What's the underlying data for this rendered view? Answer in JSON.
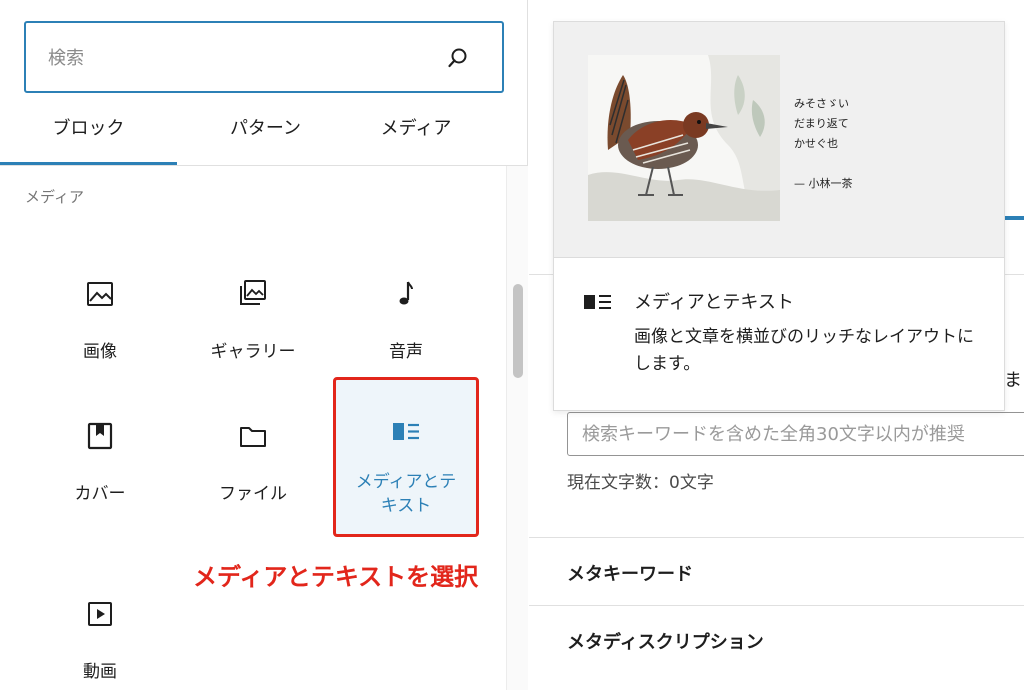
{
  "search": {
    "placeholder": "検索"
  },
  "tabs": [
    {
      "label": "ブロック",
      "active": true
    },
    {
      "label": "パターン",
      "active": false
    },
    {
      "label": "メディア",
      "active": false
    }
  ],
  "category": {
    "title": "メディア"
  },
  "blocks": [
    {
      "label": "画像",
      "icon": "image-icon"
    },
    {
      "label": "ギャラリー",
      "icon": "gallery-icon"
    },
    {
      "label": "音声",
      "icon": "audio-icon"
    },
    {
      "label": "カバー",
      "icon": "cover-icon"
    },
    {
      "label": "ファイル",
      "icon": "file-icon"
    },
    {
      "label": "メディアとテキスト",
      "icon": "media-text-icon",
      "selected": true
    },
    {
      "label": "動画",
      "icon": "video-icon"
    }
  ],
  "annotation": {
    "text": "メディアとテキストを選択"
  },
  "preview": {
    "poem_lines": [
      "みそさゞい",
      "だまり返て",
      "かせぐ也"
    ],
    "poem_author": "— 小林一茶",
    "title": "メディアとテキスト",
    "description": "画像と文章を横並びのリッチなレイアウトにします。"
  },
  "right_panel": {
    "cut_text": "ま",
    "description_placeholder": "検索キーワードを含めた全角30文字以内が推奨",
    "char_count": "現在文字数：0文字",
    "meta_keywords_title": "メタキーワード",
    "meta_description_title": "メタディスクリプション"
  },
  "colors": {
    "accent": "#2c80b6",
    "highlight_red": "#e2261b",
    "selected_bg": "#eef5fa"
  }
}
